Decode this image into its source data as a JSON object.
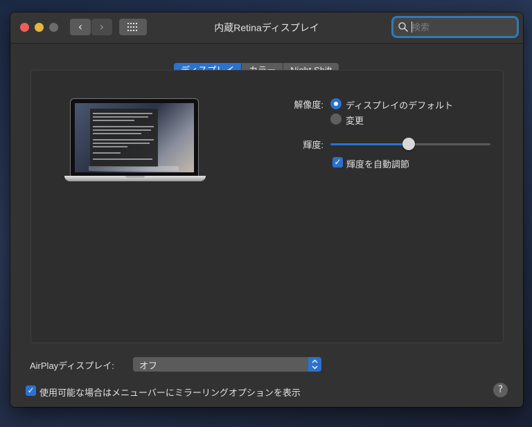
{
  "window": {
    "title": "内蔵Retinaディスプレイ",
    "back_glyph": "‹",
    "forward_glyph": "›"
  },
  "search": {
    "placeholder": "検索",
    "value": ""
  },
  "tabs": [
    {
      "label": "ディスプレイ",
      "active": true
    },
    {
      "label": "カラー",
      "active": false
    },
    {
      "label": "Night Shift",
      "active": false
    }
  ],
  "resolution": {
    "label": "解像度:",
    "options": [
      {
        "label": "ディスプレイのデフォルト",
        "selected": true
      },
      {
        "label": "変更",
        "selected": false
      }
    ]
  },
  "brightness": {
    "label": "輝度:",
    "level": 0.49,
    "auto_adjust_label": "輝度を自動調節",
    "auto_adjust_checked": true,
    "check_glyph": "✓"
  },
  "airplay": {
    "label": "AirPlayディスプレイ:",
    "selected_value": "オフ"
  },
  "mirroring": {
    "label": "使用可能な場合はメニューバーにミラーリングオプションを表示",
    "checked": true,
    "check_glyph": "✓"
  },
  "help": {
    "glyph": "?"
  },
  "colors": {
    "accent": "#2b72cf",
    "close": "#ed5f57",
    "minimize": "#e2b640",
    "window_bg": "#323232"
  },
  "icons": [
    "search-icon",
    "grid-icon",
    "chevron-left-icon",
    "chevron-right-icon",
    "laptop-icon",
    "help-icon",
    "up-down-chevron-icon",
    "checkmark-icon"
  ]
}
